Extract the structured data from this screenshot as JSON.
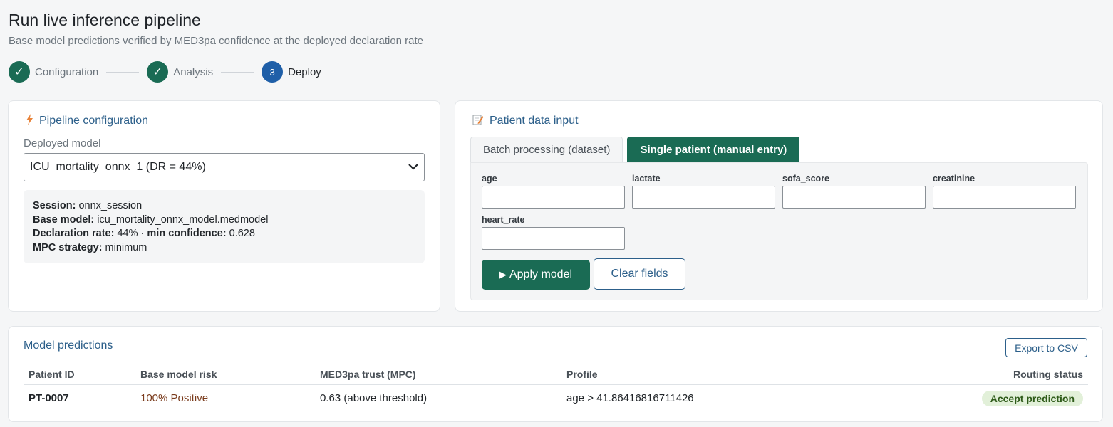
{
  "header": {
    "title": "Run live inference pipeline",
    "subtitle": "Base model predictions verified by MED3pa confidence at the deployed declaration rate"
  },
  "stepper": {
    "steps": [
      {
        "marker": "✓",
        "label": "Configuration"
      },
      {
        "marker": "✓",
        "label": "Analysis"
      },
      {
        "marker": "3",
        "label": "Deploy"
      }
    ]
  },
  "pipeline": {
    "title": "Pipeline configuration",
    "icon": "lightning-icon",
    "model_label": "Deployed model",
    "model_value": "ICU_mortality_onnx_1 (DR = 44%)",
    "info": {
      "session_label": "Session:",
      "session_value": "onnx_session",
      "base_model_label": "Base model:",
      "base_model_value": "icu_mortality_onnx_model.medmodel",
      "dr_label": "Declaration rate:",
      "dr_value": "44%",
      "separator": "·",
      "min_conf_label": "min confidence:",
      "min_conf_value": "0.628",
      "mpc_label": "MPC strategy:",
      "mpc_value": "minimum"
    }
  },
  "patient": {
    "title": "Patient data input",
    "icon": "memo-icon",
    "tabs": [
      {
        "label": "Batch processing (dataset)"
      },
      {
        "label": "Single patient (manual entry)"
      }
    ],
    "fields": [
      {
        "label": "age",
        "value": ""
      },
      {
        "label": "lactate",
        "value": ""
      },
      {
        "label": "sofa_score",
        "value": ""
      },
      {
        "label": "creatinine",
        "value": ""
      },
      {
        "label": "heart_rate",
        "value": ""
      }
    ],
    "apply_label": "Apply model",
    "clear_label": "Clear fields"
  },
  "predictions": {
    "title": "Model predictions",
    "export_label": "Export to CSV",
    "columns": [
      "Patient ID",
      "Base model risk",
      "MED3pa trust (MPC)",
      "Profile",
      "Routing status"
    ],
    "rows": [
      {
        "patient_id": "PT-0007",
        "risk": "100% Positive",
        "trust": "0.63 (above threshold)",
        "profile": "age > 41.86416816711426",
        "status": "Accept prediction"
      }
    ]
  },
  "colors": {
    "primary_green": "#1a6b54",
    "active_blue": "#1f5fa8",
    "link_blue": "#2c5f8a",
    "accept_badge_bg": "#e2f0d9"
  }
}
